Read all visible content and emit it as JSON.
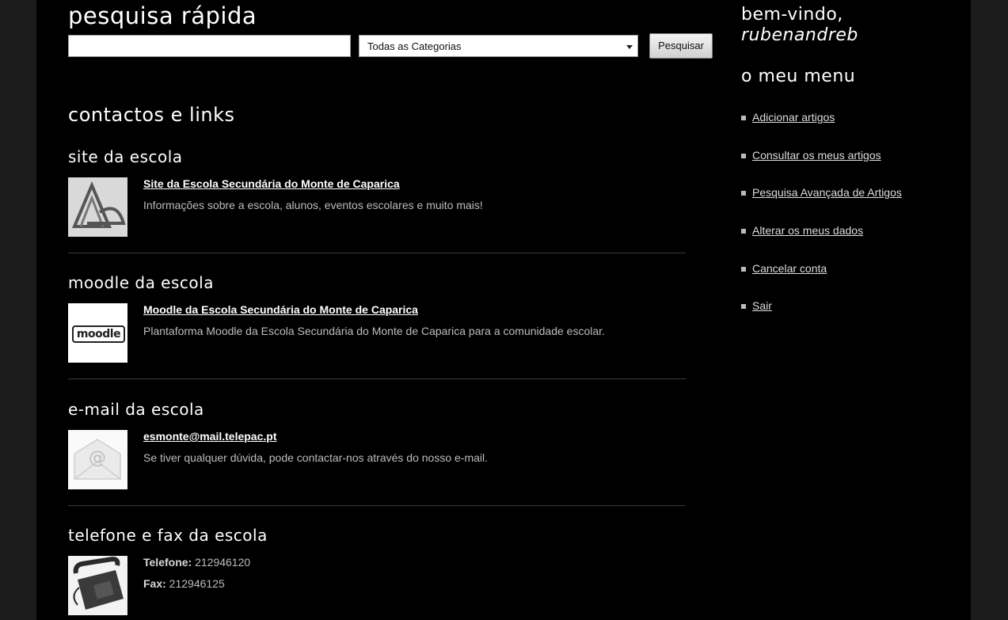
{
  "search": {
    "title": "pesquisa rápida",
    "input_value": "",
    "category_selected": "Todas as Categorias",
    "button_label": "Pesquisar"
  },
  "contacts": {
    "title": "contactos e links",
    "sections": [
      {
        "heading": "site da escola",
        "link": "Site da Escola Secundária do Monte de Caparica",
        "description": "Informações sobre a escola, alunos, eventos escolares e muito mais!"
      },
      {
        "heading": "moodle da escola",
        "link": "Moodle da Escola Secundária do Monte de Caparica",
        "description": "Plantaforma Moodle da Escola Secundária do Monte de Caparica para a comunidade escolar."
      },
      {
        "heading": "e-mail da escola",
        "link": "esmonte@mail.telepac.pt",
        "description": "Se tiver qualquer dúvida, pode contactar-nos através do nosso e-mail."
      },
      {
        "heading": "telefone e fax da escola",
        "phone_label": "Telefone:",
        "phone_value": " 212946120",
        "fax_label": "Fax:",
        "fax_value": " 212946125"
      }
    ],
    "moodle_logo_text": "moodle"
  },
  "sidebar": {
    "welcome": "bem-vindo,",
    "username": "rubenandreb",
    "menu_title": "o meu menu",
    "menu": [
      "Adicionar artigos",
      "Consultar os meus artigos",
      "Pesquisa Avançada de Artigos",
      "Alterar os meus dados",
      "Cancelar conta",
      "Sair"
    ]
  },
  "colors": {
    "page_background": "#000000",
    "outer_background": "#1c1c1c",
    "text": "#cfcfcf"
  }
}
